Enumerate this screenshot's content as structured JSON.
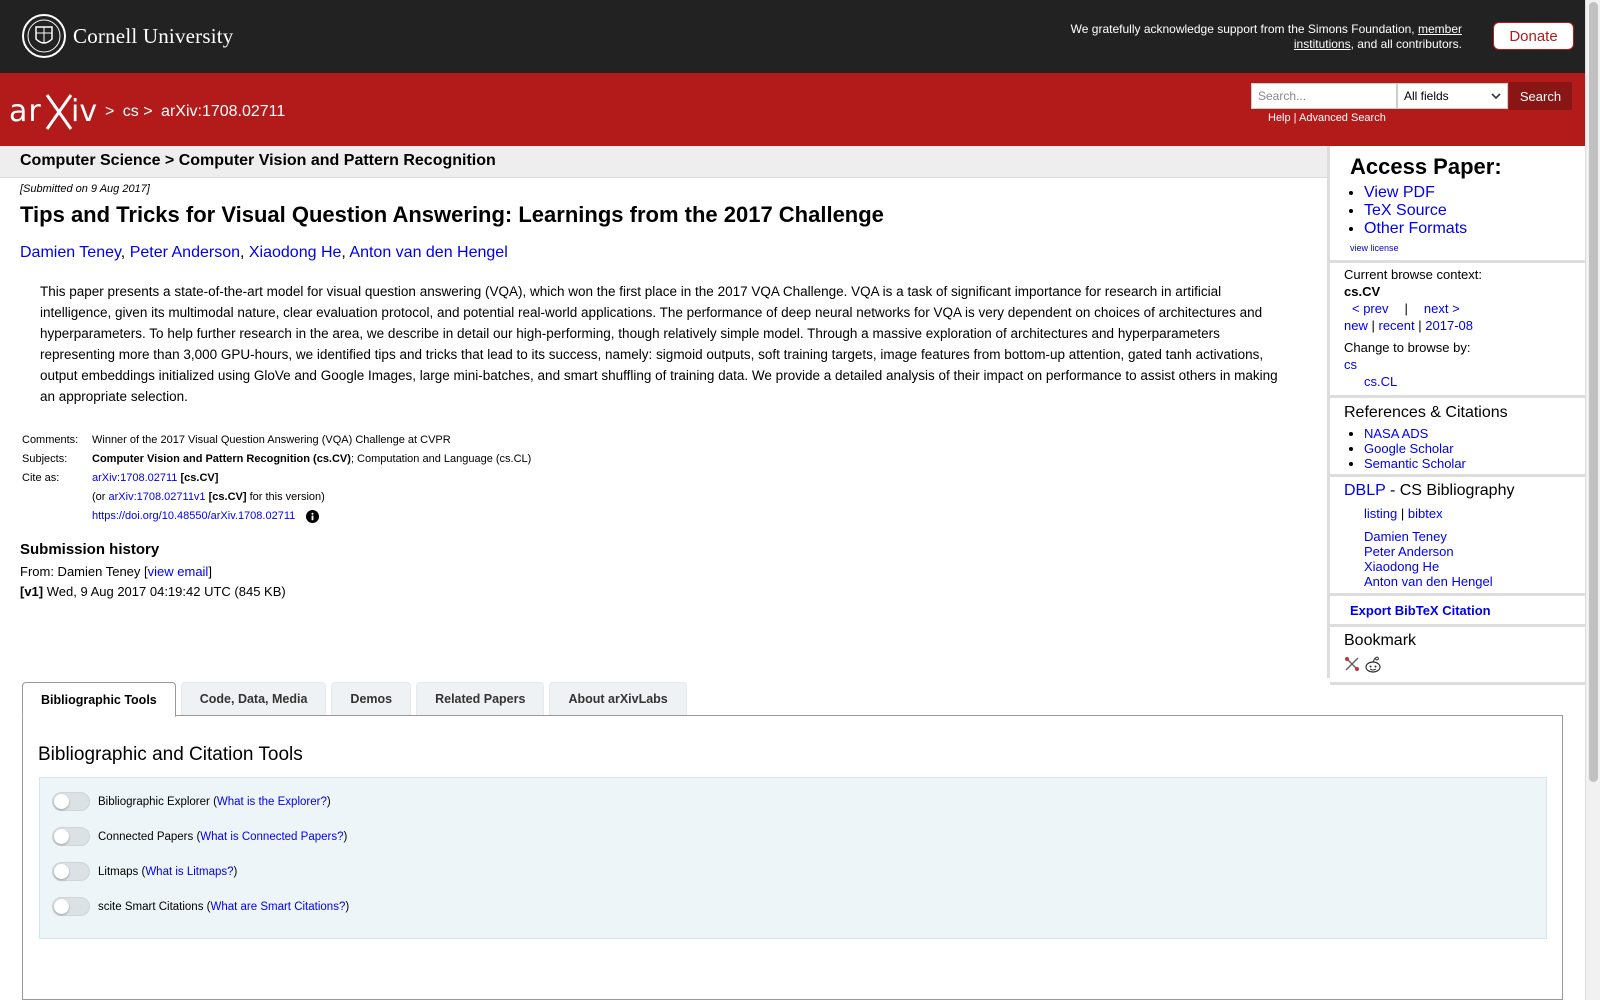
{
  "header": {
    "university": "Cornell University",
    "support_text_pre": "We gratefully acknowledge support from the Simons Foundation,",
    "support_link": "member institutions",
    "support_text_post": ", and all contributors.",
    "donate": "Donate"
  },
  "arxiv_bar": {
    "breadcrumb_sep": ">",
    "breadcrumb_cs": "cs",
    "breadcrumb_id": "arXiv:1708.02711",
    "search_placeholder": "Search...",
    "field_selected": "All fields",
    "search_button": "Search",
    "help": "Help",
    "help_sep": " | ",
    "advanced": "Advanced Search"
  },
  "subject_header": "Computer Science > Computer Vision and Pattern Recognition",
  "paper": {
    "submitted": "[Submitted on 9 Aug 2017]",
    "title": "Tips and Tricks for Visual Question Answering: Learnings from the 2017 Challenge",
    "authors": [
      "Damien Teney",
      "Peter Anderson",
      "Xiaodong He",
      "Anton van den Hengel"
    ],
    "abstract": "This paper presents a state-of-the-art model for visual question answering (VQA), which won the first place in the 2017 VQA Challenge. VQA is a task of significant importance for research in artificial intelligence, given its multimodal nature, clear evaluation protocol, and potential real-world applications. The performance of deep neural networks for VQA is very dependent on choices of architectures and hyperparameters. To help further research in the area, we describe in detail our high-performing, though relatively simple model. Through a massive exploration of architectures and hyperparameters representing more than 3,000 GPU-hours, we identified tips and tricks that lead to its success, namely: sigmoid outputs, soft training targets, image features from bottom-up attention, gated tanh activations, output embeddings initialized using GloVe and Google Images, large mini-batches, and smart shuffling of training data. We provide a detailed analysis of their impact on performance to assist others in making an appropriate selection.",
    "meta": {
      "comments_label": "Comments:",
      "comments": "Winner of the 2017 Visual Question Answering (VQA) Challenge at CVPR",
      "subjects_label": "Subjects:",
      "subject_primary": "Computer Vision and Pattern Recognition (cs.CV)",
      "subject_secondary": "; Computation and Language (cs.CL)",
      "cite_label": "Cite as:",
      "cite_id": "arXiv:1708.02711",
      "cite_cat": "[cs.CV]",
      "cite_or": "(or",
      "cite_version": "arXiv:1708.02711v1",
      "cite_version_cat": "[cs.CV]",
      "cite_version_post": "for this version)",
      "doi": "https://doi.org/10.48550/arXiv.1708.02711"
    },
    "history": {
      "heading": "Submission history",
      "from_pre": "From: Damien Teney [",
      "view_email": "view email",
      "from_post": "]",
      "v1_label": "[v1]",
      "v1_text": " Wed, 9 Aug 2017 04:19:42 UTC (845 KB)"
    }
  },
  "sidebar": {
    "access_heading": "Access Paper:",
    "access_links": [
      "View PDF",
      "TeX Source",
      "Other Formats"
    ],
    "view_license": "view license",
    "browse_context_label": "Current browse context:",
    "browse_context": "cs.CV",
    "prev": "< prev",
    "pipe": "|",
    "next": "next >",
    "new": "new",
    "recent": "recent",
    "month": "2017-08",
    "change_browse": "Change to browse by:",
    "browse_cs": "cs",
    "browse_cscl": "cs.CL",
    "refs_heading": "References & Citations",
    "refs_links": [
      "NASA ADS",
      "Google Scholar",
      "Semantic Scholar"
    ],
    "dblp": "DBLP",
    "dblp_rest": " - CS Bibliography",
    "listing": "listing",
    "bibtex": "bibtex",
    "dblp_authors": [
      "Damien Teney",
      "Peter Anderson",
      "Xiaodong He",
      "Anton van den Hengel"
    ],
    "export_bibtex": "Export BibTeX Citation",
    "bookmark_heading": "Bookmark"
  },
  "tabs": {
    "items": [
      "Bibliographic Tools",
      "Code, Data, Media",
      "Demos",
      "Related Papers",
      "About arXivLabs"
    ],
    "active": 0
  },
  "tools": {
    "heading": "Bibliographic and Citation Tools",
    "items": [
      {
        "label": "Bibliographic Explorer",
        "link": "What is the Explorer?"
      },
      {
        "label": "Connected Papers",
        "link": "What is Connected Papers?"
      },
      {
        "label": "Litmaps",
        "link": "What is Litmaps?"
      },
      {
        "label": "scite Smart Citations",
        "link": "What are Smart Citations?"
      }
    ]
  },
  "colors": {
    "cornell_bar": "#222222",
    "arxiv_red": "#b31b1b",
    "link_blue": "#0000ee"
  }
}
